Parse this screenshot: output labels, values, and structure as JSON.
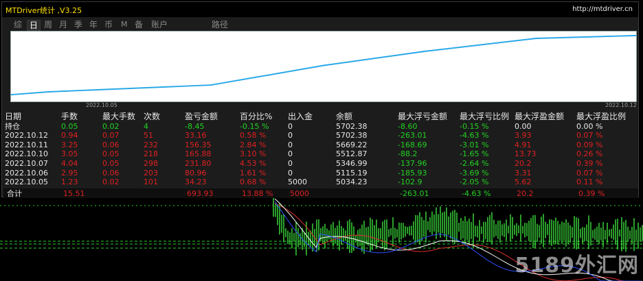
{
  "window": {
    "title": "MTDriver统计 ,V3.25",
    "url": "http://mtdriver.cn"
  },
  "tabs": [
    {
      "label": "综",
      "active": false
    },
    {
      "label": "日",
      "active": true
    },
    {
      "label": "周",
      "active": false
    },
    {
      "label": "月",
      "active": false
    },
    {
      "label": "季",
      "active": false
    },
    {
      "label": "年",
      "active": false
    },
    {
      "label": "币",
      "active": false
    },
    {
      "label": "M",
      "active": false
    },
    {
      "label": "备",
      "active": false
    },
    {
      "label": "账户",
      "active": false
    },
    {
      "label": "路径",
      "active": false
    }
  ],
  "chart_data": {
    "type": "line",
    "x_start_label": "2022.10.05",
    "x_end_label": "2022.10.12",
    "line_color": "#29a8e8",
    "series": [
      {
        "values": [
          5000,
          5034.23,
          5115.19,
          5346.99,
          5512.87,
          5669.22,
          5702.38
        ]
      }
    ]
  },
  "table": {
    "headers": [
      "日期",
      "手数",
      "最大手数",
      "次数",
      "盈亏金额",
      "百分比%",
      "出入金",
      "余额",
      "最大浮亏金额",
      "最大浮亏比例",
      "最大浮盈金额",
      "最大浮盈比例"
    ],
    "rows": [
      [
        "持仓",
        "0.05",
        "0.02",
        "4",
        "-8.45",
        "-0.15 %",
        "0",
        "5702.38",
        "-8.60",
        "-0.15 %",
        "0.00",
        "0.00 %"
      ],
      [
        "2022.10.12",
        "0.94",
        "0.07",
        "51",
        "33.16",
        "0.58 %",
        "0",
        "5702.38",
        "-263.01",
        "-4.63 %",
        "3.93",
        "0.07 %"
      ],
      [
        "2022.10.11",
        "3.25",
        "0.06",
        "232",
        "156.35",
        "2.84 %",
        "0",
        "5669.22",
        "-168.69",
        "-3.01 %",
        "4.91",
        "0.09 %"
      ],
      [
        "2022.10.10",
        "3.05",
        "0.05",
        "218",
        "165.88",
        "3.10 %",
        "0",
        "5512.87",
        "-88.2",
        "-1.65 %",
        "13.73",
        "0.26 %"
      ],
      [
        "2022.10.07",
        "4.04",
        "0.05",
        "298",
        "231.80",
        "4.53 %",
        "0",
        "5346.99",
        "-137.96",
        "-2.64 %",
        "20.2",
        "0.39 %"
      ],
      [
        "2022.10.06",
        "2.95",
        "0.06",
        "203",
        "80.96",
        "1.61 %",
        "0",
        "5115.19",
        "-185.93",
        "-3.69 %",
        "3.31",
        "0.07 %"
      ],
      [
        "2022.10.05",
        "1.23",
        "0.02",
        "101",
        "34.23",
        "0.68 %",
        "5000",
        "5034.23",
        "-102.9",
        "-2.05 %",
        "5.62",
        "0.11 %"
      ]
    ],
    "total": [
      "合计",
      "15.51",
      "",
      "",
      "693.93",
      "13.88 %",
      "5000",
      "",
      "-263.01",
      "-4.63 %",
      "20.2",
      "0.39 %"
    ]
  },
  "colors": {
    "profit": "#e02020",
    "loss": "#22d322",
    "title": "#ffe000",
    "panel": "#1c1c1c"
  },
  "watermark": "5189外汇网"
}
